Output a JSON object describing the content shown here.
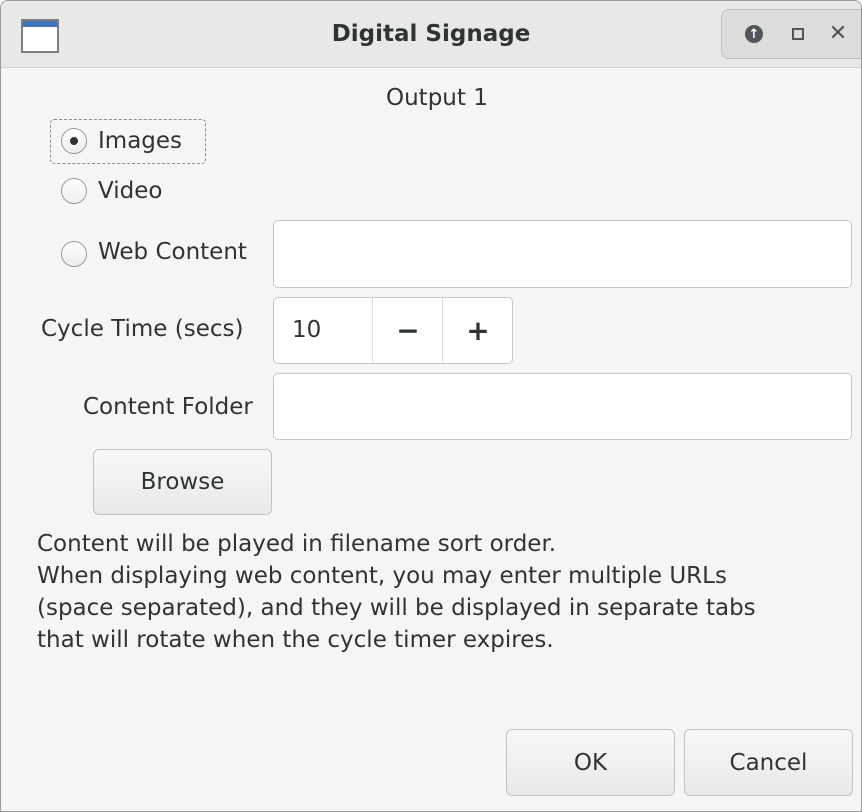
{
  "window": {
    "title": "Digital Signage",
    "controls": [
      "restore-up-icon",
      "maximize-icon",
      "close-icon"
    ]
  },
  "form": {
    "output_label": "Output 1",
    "content_type": {
      "selected": "Images",
      "options": [
        "Images",
        "Video",
        "Web Content"
      ]
    },
    "web_content_value": "",
    "cycle_time": {
      "label": "Cycle Time (secs)",
      "value": "10",
      "minus": "−",
      "plus": "+"
    },
    "content_folder": {
      "label": "Content Folder",
      "value": ""
    },
    "browse_label": "Browse",
    "info_lines": [
      "Content will be played in filename sort order.",
      "When displaying web content, you may enter multiple URLs",
      "(space separated), and they will be displayed in separate tabs",
      "that will rotate when the cycle timer expires."
    ]
  },
  "footer": {
    "ok_label": "OK",
    "cancel_label": "Cancel"
  },
  "colors": {
    "accent": "#3f74c2",
    "window_bg": "#f6f5f4",
    "text": "#2e3436"
  }
}
